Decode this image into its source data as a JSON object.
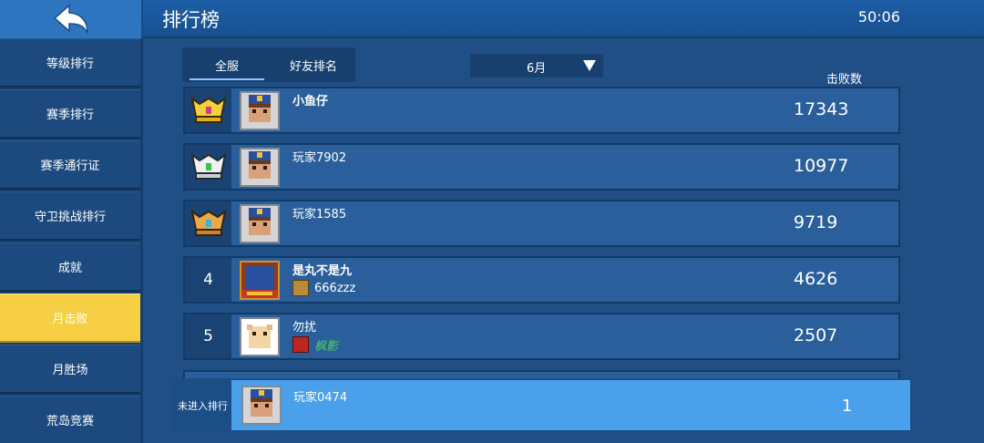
{
  "header": {
    "title": "排行榜",
    "clock": "50:06",
    "back_icon": "back-arrow-icon"
  },
  "sidebar": {
    "items": [
      {
        "label": "等级排行"
      },
      {
        "label": "赛季排行"
      },
      {
        "label": "赛季通行证"
      },
      {
        "label": "守卫挑战排行"
      },
      {
        "label": "成就"
      },
      {
        "label": "月击败",
        "active": true
      },
      {
        "label": "月胜场"
      },
      {
        "label": "荒岛竞赛"
      }
    ]
  },
  "tabs": [
    {
      "label": "全服",
      "active": true
    },
    {
      "label": "好友排名"
    }
  ],
  "month_select": {
    "value": "6月"
  },
  "column_header": "击败数",
  "rows": [
    {
      "rank_icon": "gold-crown-badge-icon",
      "name": "小鱼仔",
      "score": "17343"
    },
    {
      "rank_icon": "silver-crown-badge-icon",
      "name": "玩家7902",
      "score": "10977"
    },
    {
      "rank_icon": "bronze-crown-badge-icon",
      "name": "玩家1585",
      "score": "9719"
    },
    {
      "rank": "4",
      "name": "是丸不是九",
      "tag": "666zzz",
      "score": "4626"
    },
    {
      "rank": "5",
      "name": "勿扰",
      "tag": "枫影",
      "score": "2507"
    }
  ],
  "self": {
    "rank_label": "未进入排行",
    "name": "玩家0474",
    "score": "1"
  },
  "colors": {
    "active_tab": "#f6cf45",
    "self_bar": "#4aa0ea",
    "row": "#2a5f9c"
  }
}
